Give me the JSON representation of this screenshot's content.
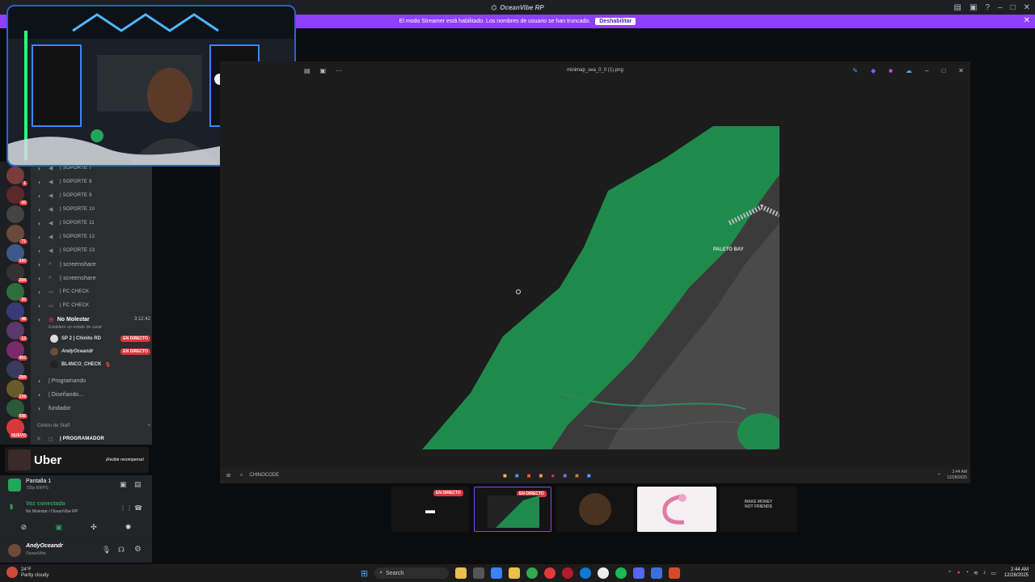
{
  "app": {
    "title": "OceanVibe RP"
  },
  "banner": {
    "text": "El modo Streamer está habilitado. Los nombres de usuario se han truncado.",
    "button": "Deshabilitar"
  },
  "servers": [
    {
      "badge": "1"
    },
    {
      "badge": "43"
    },
    {
      "badge": ""
    },
    {
      "badge": "71"
    },
    {
      "badge": "142"
    },
    {
      "badge": "294"
    },
    {
      "badge": "20"
    },
    {
      "badge": "48"
    },
    {
      "badge": "13"
    },
    {
      "badge": "403"
    },
    {
      "badge": "284"
    },
    {
      "badge": "239"
    },
    {
      "badge": "936"
    },
    {
      "badge": "NUEVO"
    }
  ],
  "channels": {
    "items": [
      {
        "label": "| SOPORTE 7"
      },
      {
        "label": "| SOPORTE 8"
      },
      {
        "label": "| SOPORTE 9"
      },
      {
        "label": "| SOPORTE 10"
      },
      {
        "label": "| SOPORTE 11"
      },
      {
        "label": "| SOPORTE 12"
      },
      {
        "label": "| SOPORTE 13"
      },
      {
        "label": "| screenshare"
      },
      {
        "label": "| screenshare"
      },
      {
        "label": "| PC CHECK"
      },
      {
        "label": "| PC CHECK"
      }
    ],
    "active": {
      "label": "No Molestar",
      "timer": "3:12:42",
      "status": "Establece un estado de canal"
    },
    "users": [
      {
        "name": "SP 2 | Chinito RD",
        "live": "EN DIRECTO"
      },
      {
        "name": "AndyOceandr",
        "live": "EN DIRECTO"
      },
      {
        "name": "BL4NCO_CHECK",
        "live": ""
      }
    ],
    "more": [
      {
        "label": "| Programando"
      },
      {
        "label": "| Diseñando..."
      },
      {
        "label": "fundador"
      }
    ],
    "category": "Centro de Staff",
    "programmer": "| PROGRAMADOR"
  },
  "uber": {
    "logo": "Uber",
    "cta": "¡Recibir recompensa!"
  },
  "screen": {
    "title": "Pantalla 1",
    "sub": "720p 60FPS"
  },
  "voice": {
    "title": "Voz conectada",
    "sub": "No Molestar / OceanVibe RP"
  },
  "user": {
    "name": "AndyOceandr",
    "server": "OceanVibe"
  },
  "viewer": {
    "filename": "minimap_sea_0_0 (1).png",
    "map_label": "PALETO BAY",
    "taskbar_text": "CHINOCODE",
    "clock_time": "2:44 AM",
    "clock_date": "12/28/2025"
  },
  "thumbs": {
    "live1": "EN DIRECTO",
    "live2": "EN DIRECTO",
    "poster": "MAKE MONEY NOT FRIENDS"
  },
  "taskbar": {
    "weather_temp": "24°F",
    "weather_desc": "Partly cloudy",
    "search": "Search",
    "time": "2:44 AM",
    "date": "12/28/2025"
  },
  "colors": {
    "accent": "#8f3ffb",
    "live": "#da373c",
    "online": "#23a55a",
    "map_green": "#1f8a4c"
  }
}
